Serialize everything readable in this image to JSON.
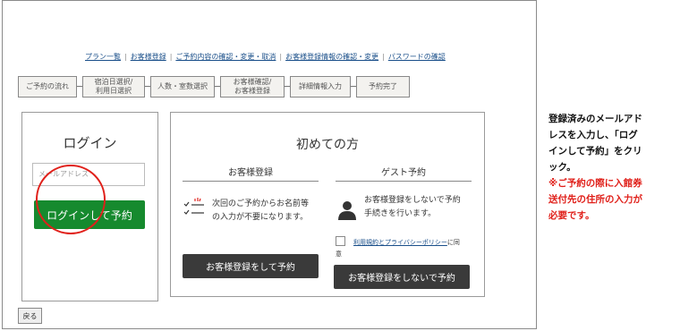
{
  "top_links": [
    "プラン一覧",
    "お客様登録",
    "ご予約内容の確認・変更・取消",
    "お客様登録情報の確認・変更",
    "パスワードの確認"
  ],
  "top_links_separator": "|",
  "steps": [
    {
      "label": "ご予約の流れ"
    },
    {
      "label": "宿泊日選択/\n利用日選択"
    },
    {
      "label": "人数・室数選択"
    },
    {
      "label": "お客様確認/\nお客様登録"
    },
    {
      "label": "詳細情報入力"
    },
    {
      "label": "予約完了"
    }
  ],
  "login": {
    "title": "ログイン",
    "email_placeholder": "メールアドレス",
    "button": "ログインして予約"
  },
  "first_time": {
    "title": "初めての方",
    "register": {
      "heading": "お客様登録",
      "description_line1": "次回のご予約からお名前等",
      "description_line2": "の入力が不要になります。",
      "button": "お客様登録をして予約"
    },
    "guest": {
      "heading": "ゲスト予約",
      "description_line1": "お客様登録をしないで予約",
      "description_line2": "手続きを行います。",
      "agree_link": "利用規約とプライバシーポリシー",
      "agree_suffix": "に同",
      "agree_line2": "意",
      "button": "お客様登録をしないで予約"
    }
  },
  "back_button": "戻る",
  "note": {
    "line1": "登録済みのメールアド",
    "line2": "レスを入力し、「ログ",
    "line3": "インして予約」をクリ",
    "line4": "ック。",
    "red_line1": "※ご予約の際に入館券",
    "red_line2": "送付先の住所の入力が",
    "red_line3": "必要です。"
  },
  "colors": {
    "login_button": "#168a2e",
    "dark_button": "#3a3a3a",
    "link": "#1a4f8a",
    "annotation": "#e0201a"
  }
}
